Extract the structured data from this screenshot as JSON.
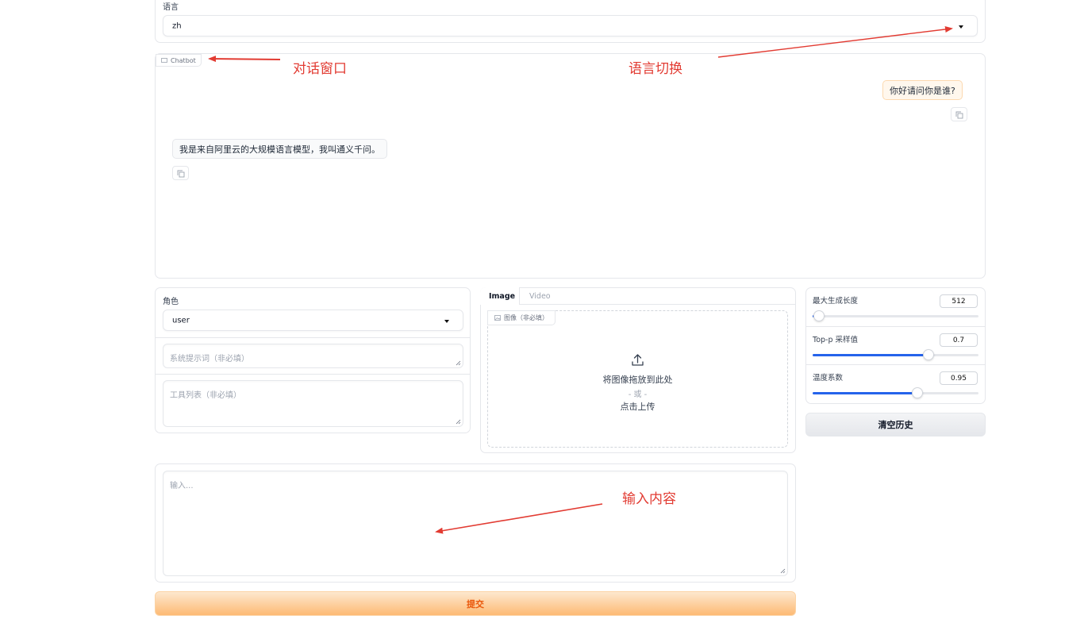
{
  "language": {
    "label": "语言",
    "selected": "zh"
  },
  "chatbot": {
    "label": "Chatbot",
    "user_message": "你好请问你是谁?",
    "bot_message": "我是来自阿里云的大规模语言模型，我叫通义千问。"
  },
  "annotations": {
    "dialog_window": "对话窗口",
    "language_switch": "语言切换",
    "input_content": "输入内容"
  },
  "role": {
    "label": "角色",
    "selected": "user",
    "system_prompt_placeholder": "系统提示词（非必填）",
    "tools_placeholder": "工具列表（非必填）"
  },
  "media": {
    "tabs": [
      "Image",
      "Video"
    ],
    "active_tab": "Image",
    "upload_label": "图像（非必填）",
    "drop_text": "将图像拖放到此处",
    "or_text": "- 或 -",
    "click_text": "点击上传"
  },
  "params": {
    "max_length": {
      "label": "最大生成长度",
      "value": "512",
      "fraction": 0.04
    },
    "top_p": {
      "label": "Top-p 采样值",
      "value": "0.7",
      "fraction": 0.7
    },
    "temperature": {
      "label": "温度系数",
      "value": "0.95",
      "fraction": 0.63
    }
  },
  "clear_button": "清空历史",
  "input": {
    "placeholder": "输入..."
  },
  "submit_button": "提交",
  "colors": {
    "accent_blue": "#2563eb",
    "annotation_red": "#e23b32",
    "submit_gradient_start": "#fde8cf",
    "submit_gradient_end": "#fdba74",
    "submit_text": "#ea580c",
    "user_bubble_bg": "#fff7ed",
    "user_bubble_border": "#fcd9b0"
  }
}
